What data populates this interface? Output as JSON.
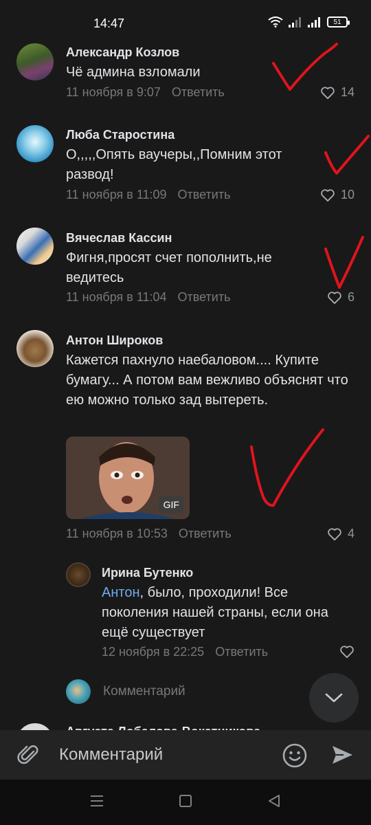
{
  "status_bar": {
    "time": "14:47",
    "battery": "51"
  },
  "comments": [
    {
      "author": "Александр Козлов",
      "text": "Чё админа взломали",
      "date": "11 ноября в 9:07",
      "reply": "Ответить",
      "likes": "14"
    },
    {
      "author": "Люба Старостина",
      "text": "О,,,,,Опять ваучеры,,Помним этот развод!",
      "date": "11 ноября в 11:09",
      "reply": "Ответить",
      "likes": "10"
    },
    {
      "author": "Вячеслав Кассин",
      "text": "Фигня,просят счет пополнить,не ведитесь",
      "date": "11 ноября в 11:04",
      "reply": "Ответить",
      "likes": "6"
    },
    {
      "author": "Антон Широков",
      "text": "Кажется пахнуло наебаловом.... Купите бумагу... А потом вам вежливо объяснят что ею можно только зад вытереть.",
      "gif_label": "GIF",
      "date": "11 ноября в 10:53",
      "reply": "Ответить",
      "likes": "4"
    }
  ],
  "thread_reply": {
    "author": "Ирина Бутенко",
    "mention": "Антон",
    "text": ", было, проходили! Все поколения нашей страны, если она ещё существует",
    "date": "12 ноября в 22:25",
    "reply": "Ответить"
  },
  "thread_reply_input": {
    "placeholder": "Комментарий"
  },
  "partial_comment": {
    "author": "Августа Лобалова-Вокатникова"
  },
  "composer": {
    "placeholder": "Комментарий"
  },
  "icons": [
    "wifi-icon",
    "signal-icon",
    "battery-icon",
    "heart-icon",
    "chevron-down-icon",
    "paperclip-icon",
    "emoji-icon",
    "send-icon",
    "menu-icon",
    "home-icon",
    "back-icon"
  ],
  "colors": {
    "background": "#19191a",
    "text": "#e1e3e6",
    "secondary": "#76787a",
    "mention": "#71aaeb",
    "annotation": "#e0141c"
  }
}
